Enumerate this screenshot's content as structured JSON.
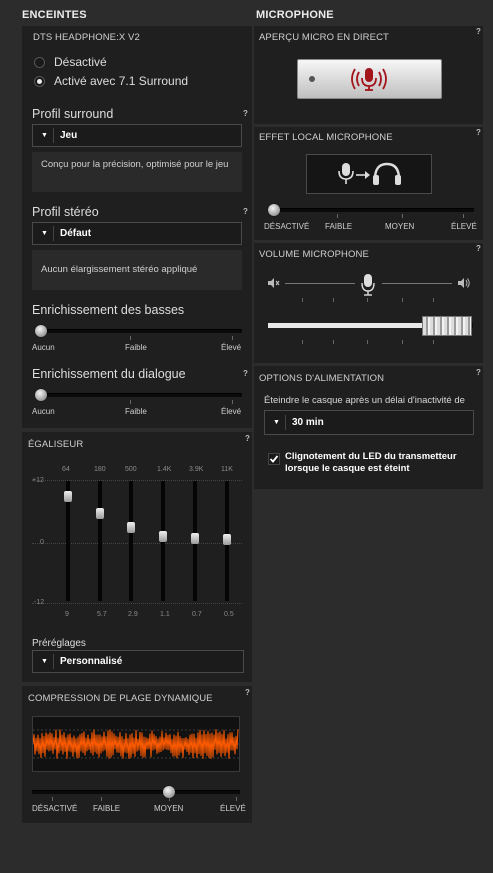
{
  "colors": {
    "accent": "#ff5a00",
    "mic_red": "#a3141b"
  },
  "left": {
    "section_title": "ENCEINTES",
    "device": {
      "title": "DTS HEADPHONE:X V2",
      "options": [
        {
          "label": "Désactivé",
          "selected": false
        },
        {
          "label": "Activé avec 7.1 Surround",
          "selected": true
        }
      ]
    },
    "surround": {
      "title": "Profil surround",
      "value": "Jeu",
      "desc": "Conçu pour la précision, optimisé pour le jeu"
    },
    "stereo": {
      "title": "Profil stéréo",
      "value": "Défaut",
      "desc": "Aucun élargissement stéréo appliqué"
    },
    "bass": {
      "title": "Enrichissement des basses",
      "labels": [
        "Aucun",
        "Faible",
        "Élevé"
      ],
      "level": 0
    },
    "dialogue": {
      "title": "Enrichissement du dialogue",
      "labels": [
        "Aucun",
        "Faible",
        "Élevé"
      ],
      "level": 0
    },
    "eq": {
      "title": "ÉGALISEUR",
      "scale": [
        "+12",
        "0",
        "-12"
      ],
      "bands": [
        {
          "freq": "64",
          "value": "9"
        },
        {
          "freq": "180",
          "value": "5.7"
        },
        {
          "freq": "500",
          "value": "2.9"
        },
        {
          "freq": "1.4K",
          "value": "1.1"
        },
        {
          "freq": "3.9K",
          "value": "0.7"
        },
        {
          "freq": "11K",
          "value": "0.5"
        }
      ],
      "presets_label": "Préréglages",
      "preset": "Personnalisé"
    },
    "drc": {
      "title": "COMPRESSION DE PLAGE DYNAMIQUE",
      "labels": [
        "DÉSACTIVÉ",
        "FAIBLE",
        "MOYEN",
        "ÉLEVÉ"
      ],
      "level": "MOYEN"
    }
  },
  "right": {
    "section_title": "MICROPHONE",
    "preview": {
      "title": "APERÇU MICRO EN DIRECT",
      "icon": "mic-waves-icon"
    },
    "local": {
      "title": "EFFET LOCAL MICROPHONE",
      "icon": "mic-to-headphones-icon",
      "labels": [
        "DÉSACTIVÉ",
        "FAIBLE",
        "MOYEN",
        "ÉLEVÉ"
      ],
      "level": "DÉSACTIVÉ"
    },
    "volume": {
      "title": "VOLUME MICROPHONE",
      "level_percent": 50
    },
    "power": {
      "title": "OPTIONS D'ALIMENTATION",
      "label": "Éteindre le casque après un délai d'inactivité de",
      "value": "30 min",
      "checkbox_label": "Clignotement du LED du transmetteur lorsque le casque est éteint",
      "checked": true
    }
  }
}
